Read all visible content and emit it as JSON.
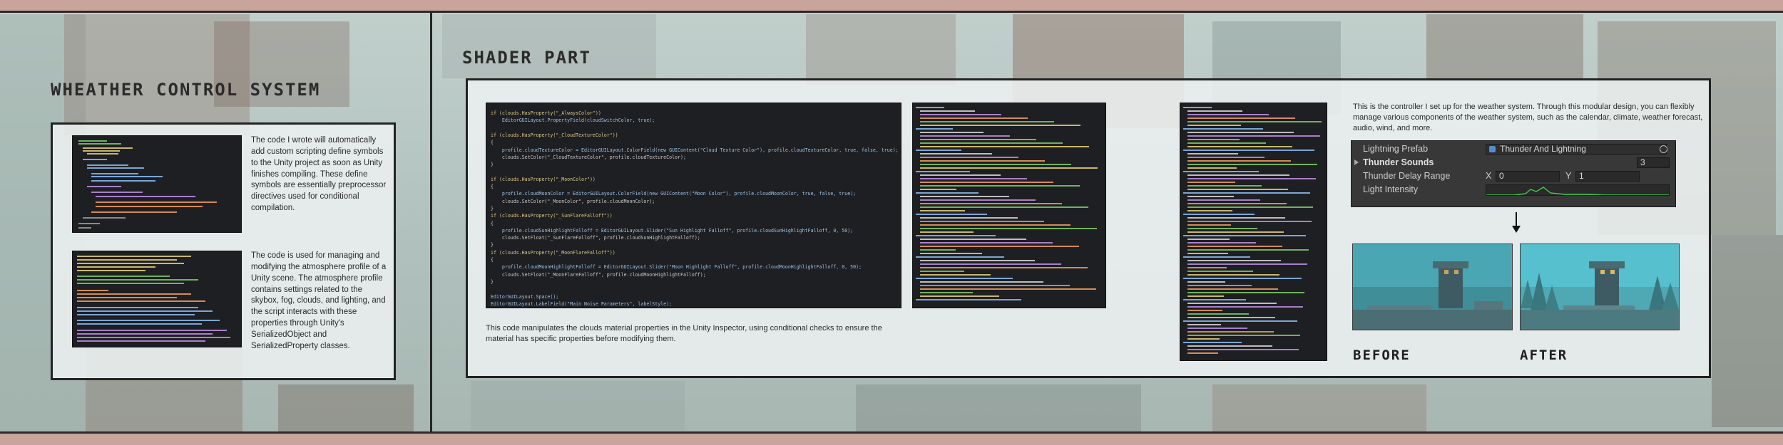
{
  "left_section": {
    "title": "WHEATHER CONTROL SYSTEM",
    "card1": {
      "text": "The code I wrote will automatically add custom scripting define symbols to the Unity project as soon as Unity finishes compiling. These define symbols are essentially preprocessor directives used for conditional compilation."
    },
    "card2": {
      "text": "The code is used for managing and modifying the atmosphere profile of a Unity scene. The atmosphere profile contains settings related to the skybox, fog, clouds, and lighting, and the script interacts with these properties through Unity's SerializedObject and SerializedProperty classes."
    }
  },
  "right_section": {
    "title": "SHADER PART",
    "code_main": [
      "if (clouds.HasProperty(\"_AlwaysColor\"))",
      "    EditorGUILayout.PropertyField(cloudSwitchColor, true);",
      "",
      "if (clouds.HasProperty(\"_CloudTextureColor\"))",
      "{",
      "    profile.cloudTextureColor = EditorGUILayout.ColorField(new GUIContent(\"Cloud Texture Color\"), profile.cloudTextureColor, true, false, true);",
      "    clouds.SetColor(\"_CloudTextureColor\", profile.cloudTextureColor);",
      "}",
      "",
      "if (clouds.HasProperty(\"_MoonColor\"))",
      "{",
      "    profile.cloudMoonColor = EditorGUILayout.ColorField(new GUIContent(\"Moon Color\"), profile.cloudMoonColor, true, false, true);",
      "    clouds.SetColor(\"_MoonColor\", profile.cloudMoonColor);",
      "}",
      "if (clouds.HasProperty(\"_SunFlareFalloff\"))",
      "{",
      "    profile.cloudSunHighlightFalloff = EditorGUILayout.Slider(\"Sun Highlight Falloff\", profile.cloudSunHighlightFalloff, 0, 50);",
      "    clouds.SetFloat(\"_SunFlareFalloff\", profile.cloudSunHighlightFalloff);",
      "}",
      "if (clouds.HasProperty(\"_MoonFlareFalloff\"))",
      "{",
      "    profile.cloudMoonHighlightFalloff = EditorGUILayout.Slider(\"Moon Highlight Falloff\", profile.cloudMoonHighlightFalloff, 0, 50);",
      "    clouds.SetFloat(\"_MoonFlareFalloff\", profile.cloudMoonHighlightFalloff);",
      "}",
      "",
      "EditorGUILayout.Space();",
      "EditorGUILayout.LabelField(\"Main Noise Parameters\", labelStyle);"
    ],
    "code_main_desc": "This code manipulates the clouds material properties in the Unity Inspector, using conditional checks to ensure the material has specific properties before modifying them.",
    "controller_desc": "This is the controller I set up for the weather system. Through this modular design, you can flexibly manage various components of the weather system, such as the calendar, climate, weather forecast, audio, wind, and more.",
    "inspector": {
      "lightning_prefab_label": "Lightning Prefab",
      "lightning_prefab_value": "Thunder And Lightning",
      "thunder_sounds_label": "Thunder Sounds",
      "thunder_sounds_count": "3",
      "thunder_delay_label": "Thunder Delay Range",
      "x_label": "X",
      "x_value": "0",
      "y_label": "Y",
      "y_value": "1",
      "light_intensity_label": "Light Intensity"
    },
    "before_label": "BEFORE",
    "after_label": "AFTER"
  },
  "colors": {
    "band": "#c9a49b",
    "code_bg": "#1e1f22",
    "sky_after": "#56c0cf",
    "sky_before": "#4aa6b2",
    "curve": "#3bd14a"
  }
}
